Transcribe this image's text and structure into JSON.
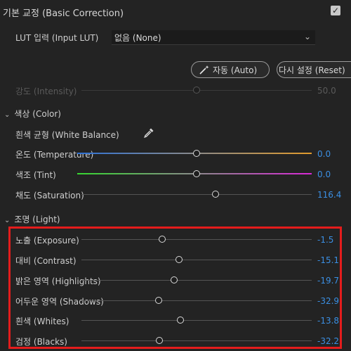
{
  "header": {
    "title": "기본 교정 (Basic Correction)",
    "enabled": true,
    "check_glyph": "✓"
  },
  "lut": {
    "label": "LUT 입력 (Input LUT)",
    "value": "없음 (None)",
    "chevron": "⌄"
  },
  "buttons": {
    "auto": "자동 (Auto)",
    "reset": "다시 설정 (Reset)"
  },
  "intensity": {
    "label": "강도 (Intensity)",
    "value": "50.0",
    "level": 50,
    "range": [
      0,
      100
    ]
  },
  "color_section": {
    "title": "색상 (Color)",
    "white_balance": {
      "label": "흰색 균형 (White Balance)",
      "icon": "eyedropper-icon"
    },
    "sliders": [
      {
        "label": "온도 (Temperature)",
        "value": "0.0",
        "level": 0,
        "range": [
          -100,
          100
        ]
      },
      {
        "label": "색조 (Tint)",
        "value": "0.0",
        "level": 0,
        "range": [
          -100,
          100
        ]
      },
      {
        "label": "채도 (Saturation)",
        "value": "116.4",
        "level": 116.4,
        "range": [
          0,
          200
        ]
      }
    ]
  },
  "light_section": {
    "title": "조명 (Light)",
    "sliders": [
      {
        "label": "노출 (Exposure)",
        "value": "-1.5",
        "level": -1.5,
        "range": [
          -5,
          5
        ]
      },
      {
        "label": "대비 (Contrast)",
        "value": "-15.1",
        "level": -15.1,
        "range": [
          -100,
          100
        ]
      },
      {
        "label": "밝은 영역 (Highlights)",
        "value": "-19.7",
        "level": -19.7,
        "range": [
          -100,
          100
        ]
      },
      {
        "label": "어두운 영역 (Shadows)",
        "value": "-32.9",
        "level": -32.9,
        "range": [
          -100,
          100
        ]
      },
      {
        "label": "흰색 (Whites)",
        "value": "-13.8",
        "level": -13.8,
        "range": [
          -100,
          100
        ]
      },
      {
        "label": "검정 (Blacks)",
        "value": "-32.2",
        "level": -32.2,
        "range": [
          -100,
          100
        ]
      }
    ]
  },
  "colors": {
    "accent": "#3b8fe3",
    "highlight": "#e41c1c",
    "background": "#232323"
  }
}
